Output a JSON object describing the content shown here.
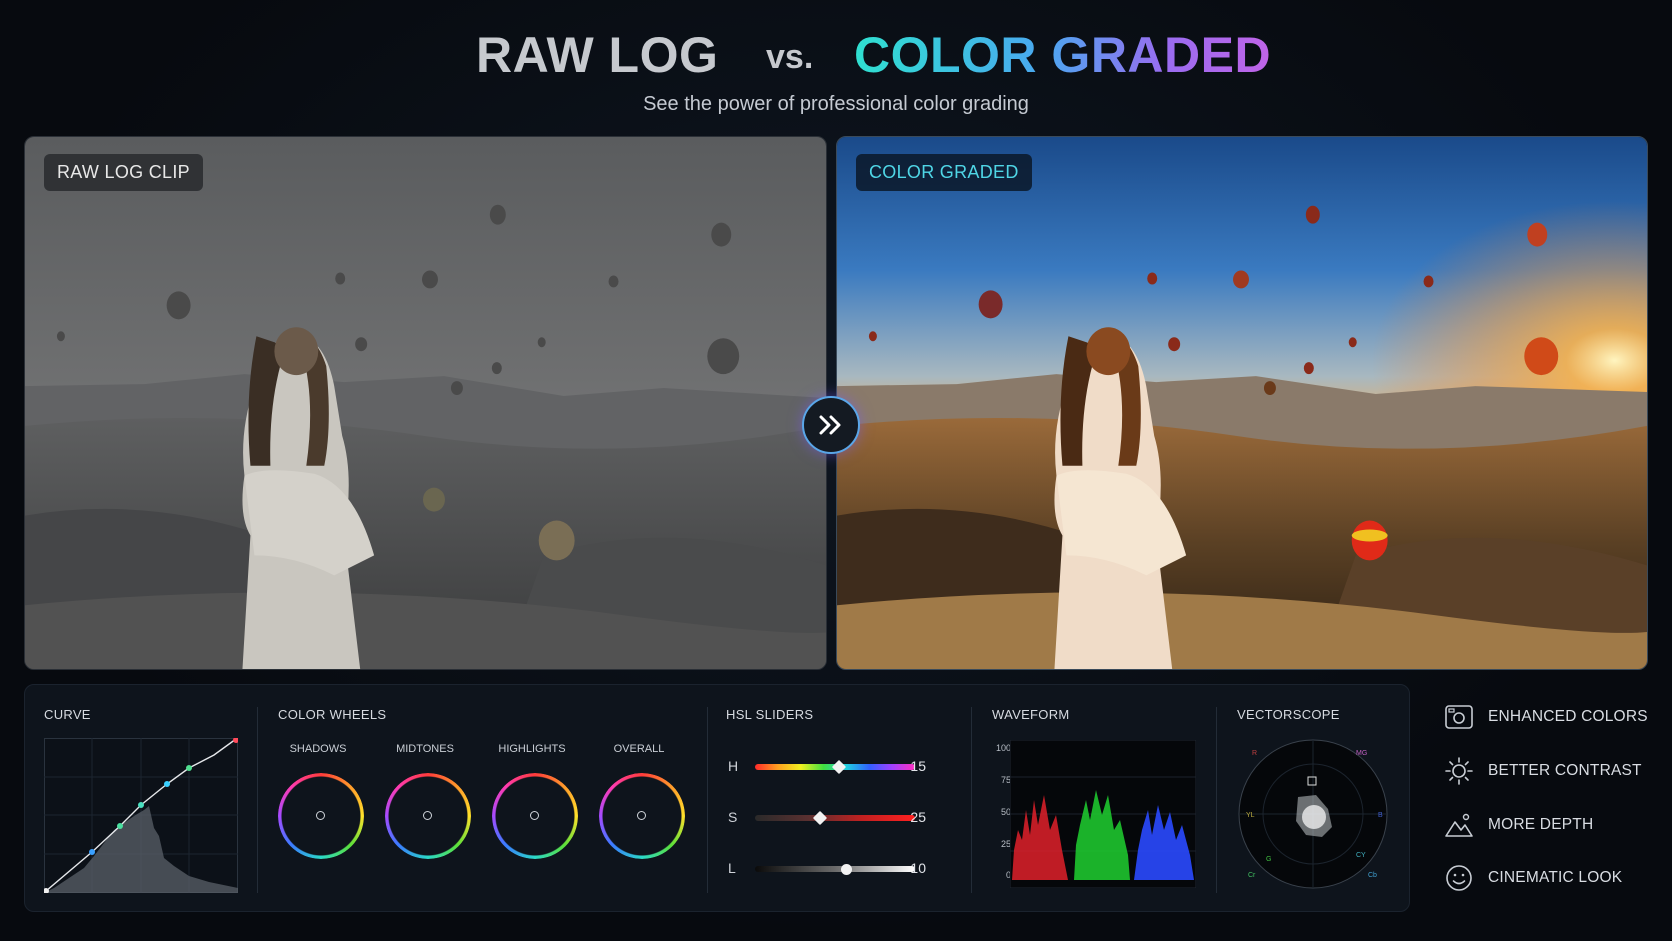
{
  "header": {
    "title_left": "RAW LOG",
    "title_vs": "vs.",
    "title_right": "COLOR GRADED",
    "subtitle": "See the power of professional color grading"
  },
  "panels": {
    "left_badge": "RAW LOG CLIP",
    "right_badge": "COLOR GRADED",
    "swap_icon": "double-chevron-right-icon"
  },
  "tools": {
    "curve": {
      "title": "CURVE"
    },
    "color_wheels": {
      "title": "COLOR WHEELS",
      "wheels": [
        "SHADOWS",
        "MIDTONES",
        "HIGHLIGHTS",
        "OVERALL"
      ]
    },
    "hsl": {
      "title": "HSL SLIDERS",
      "sliders": [
        {
          "label": "H",
          "value": "15"
        },
        {
          "label": "S",
          "value": "25"
        },
        {
          "label": "L",
          "value": "10"
        }
      ]
    },
    "waveform": {
      "title": "WAVEFORM",
      "scale": [
        "100",
        "75",
        "50",
        "25",
        "0"
      ]
    },
    "vectorscope": {
      "title": "VECTORSCOPE",
      "targets": [
        "R",
        "MG",
        "YL",
        "CY",
        "G",
        "B",
        "Cr",
        "Cb"
      ]
    }
  },
  "features": [
    {
      "label": "ENHANCED COLORS",
      "icon": "image-adjust-icon"
    },
    {
      "label": "BETTER CONTRAST",
      "icon": "sun-icon"
    },
    {
      "label": "MORE DEPTH",
      "icon": "landscape-icon"
    },
    {
      "label": "CINEMATIC LOOK",
      "icon": "smiley-icon"
    }
  ],
  "colors": {
    "accent_cyan": "#2fe0d0",
    "accent_purple": "#c064e8",
    "background": "#070a0f"
  }
}
